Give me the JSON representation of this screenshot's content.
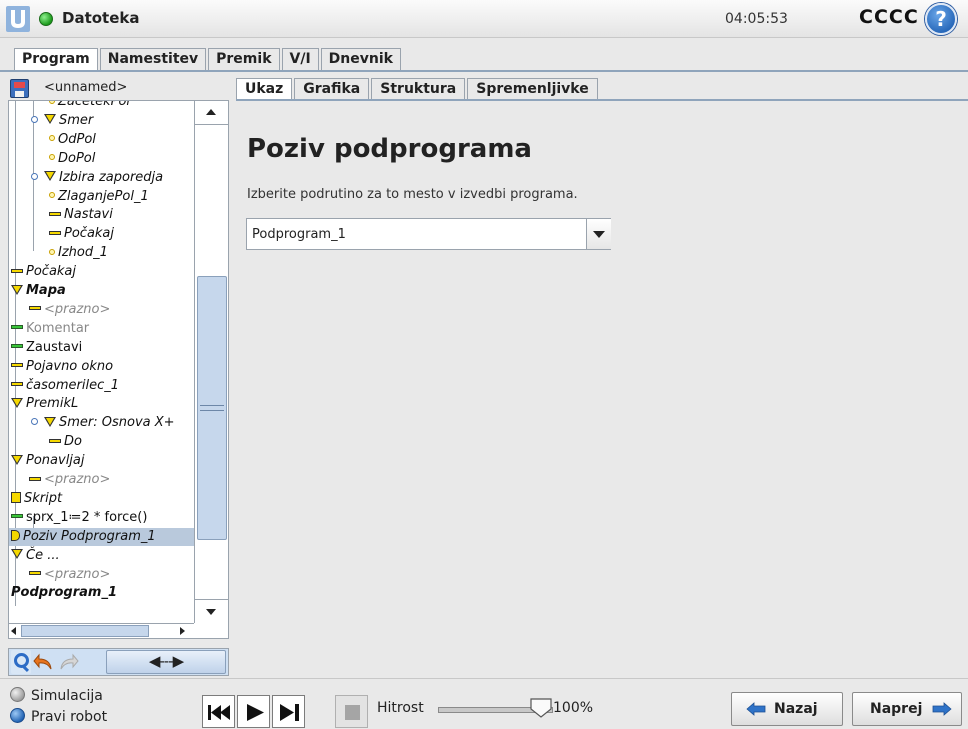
{
  "titlebar": {
    "app_title": "Datoteka",
    "clock": "04:05:53",
    "robot_name": "CCCC",
    "help_glyph": "?",
    "status_color": "#1c9a1c"
  },
  "main_tabs": [
    "Program",
    "Namestitev",
    "Premik",
    "V/I",
    "Dnevnik"
  ],
  "main_tab_active": "Program",
  "file": {
    "name": "<unnamed>"
  },
  "tree": [
    {
      "label": "ZacetekPol",
      "icon": "point-icon",
      "indent": 3,
      "style": "ital"
    },
    {
      "label": "Smer",
      "icon": "folder-triangle-icon",
      "indent": 2,
      "style": "ital"
    },
    {
      "label": "OdPol",
      "icon": "point-icon",
      "indent": 3,
      "style": "ital"
    },
    {
      "label": "DoPol",
      "icon": "point-icon",
      "indent": 3,
      "style": "ital"
    },
    {
      "label": "Izbira zaporedja",
      "icon": "folder-triangle-icon",
      "indent": 2,
      "style": "ital"
    },
    {
      "label": "ZlaganjePol_1",
      "icon": "point-icon",
      "indent": 3,
      "style": "ital"
    },
    {
      "label": "Nastavi",
      "icon": "bar-icon",
      "indent": 3,
      "style": "ital"
    },
    {
      "label": "Počakaj",
      "icon": "bar-icon",
      "indent": 3,
      "style": "ital"
    },
    {
      "label": "Izhod_1",
      "icon": "point-icon",
      "indent": 3,
      "style": "ital"
    },
    {
      "label": "Počakaj",
      "icon": "bar-icon",
      "indent": 0,
      "style": "ital"
    },
    {
      "label": "Mapa",
      "icon": "folder-triangle-icon",
      "indent": 0,
      "style": "ital bold"
    },
    {
      "label": "<prazno>",
      "icon": "bar-icon",
      "indent": 1,
      "style": "ital gray"
    },
    {
      "label": "Komentar",
      "icon": "bar-green-icon",
      "indent": 0,
      "style": "gray"
    },
    {
      "label": "Zaustavi",
      "icon": "bar-green-icon",
      "indent": 0,
      "style": ""
    },
    {
      "label": "Pojavno okno",
      "icon": "bar-icon",
      "indent": 0,
      "style": "ital"
    },
    {
      "label": "časomerilec_1",
      "icon": "bar-icon",
      "indent": 0,
      "style": "ital"
    },
    {
      "label": "PremikL",
      "icon": "folder-triangle-icon",
      "indent": 0,
      "style": "ital"
    },
    {
      "label": "Smer: Osnova X+",
      "icon": "folder-triangle-icon",
      "indent": 2,
      "style": "ital"
    },
    {
      "label": "Do",
      "icon": "bar-icon",
      "indent": 3,
      "style": "ital"
    },
    {
      "label": "Ponavljaj",
      "icon": "folder-triangle-icon",
      "indent": 0,
      "style": "ital"
    },
    {
      "label": "<prazno>",
      "icon": "bar-icon",
      "indent": 1,
      "style": "ital gray"
    },
    {
      "label": "Skript",
      "icon": "script-icon",
      "indent": 0,
      "style": "ital"
    },
    {
      "label": "sprx_1≔2 * force()",
      "icon": "bar-green-icon",
      "indent": 0,
      "style": ""
    },
    {
      "label": "Poziv Podprogram_1",
      "icon": "call-icon",
      "indent": 0,
      "style": "ital selected"
    },
    {
      "label": "Če ...",
      "icon": "folder-triangle-icon",
      "indent": 0,
      "style": "ital"
    },
    {
      "label": "<prazno>",
      "icon": "bar-icon",
      "indent": 1,
      "style": "ital gray"
    },
    {
      "label": "Podprogram_1",
      "icon": "none",
      "indent": -1,
      "style": "ital bold"
    }
  ],
  "left_toolbar": {
    "search": "search-icon",
    "undo": "undo-icon",
    "redo": "redo-icon",
    "move_label": "◀---▶"
  },
  "content_tabs": [
    "Ukaz",
    "Grafika",
    "Struktura",
    "Spremenljivke"
  ],
  "content_tab_active": "Ukaz",
  "content": {
    "title": "Poziv podprograma",
    "description": "Izberite podrutino za to mesto v izvedbi programa.",
    "select_value": "Podprogram_1"
  },
  "bottom": {
    "mode_sim": "Simulacija",
    "mode_real": "Pravi robot",
    "speed_label": "Hitrost",
    "speed_value": "100%",
    "speed_fraction": 1.0,
    "back_label": "Nazaj",
    "next_label": "Naprej"
  }
}
